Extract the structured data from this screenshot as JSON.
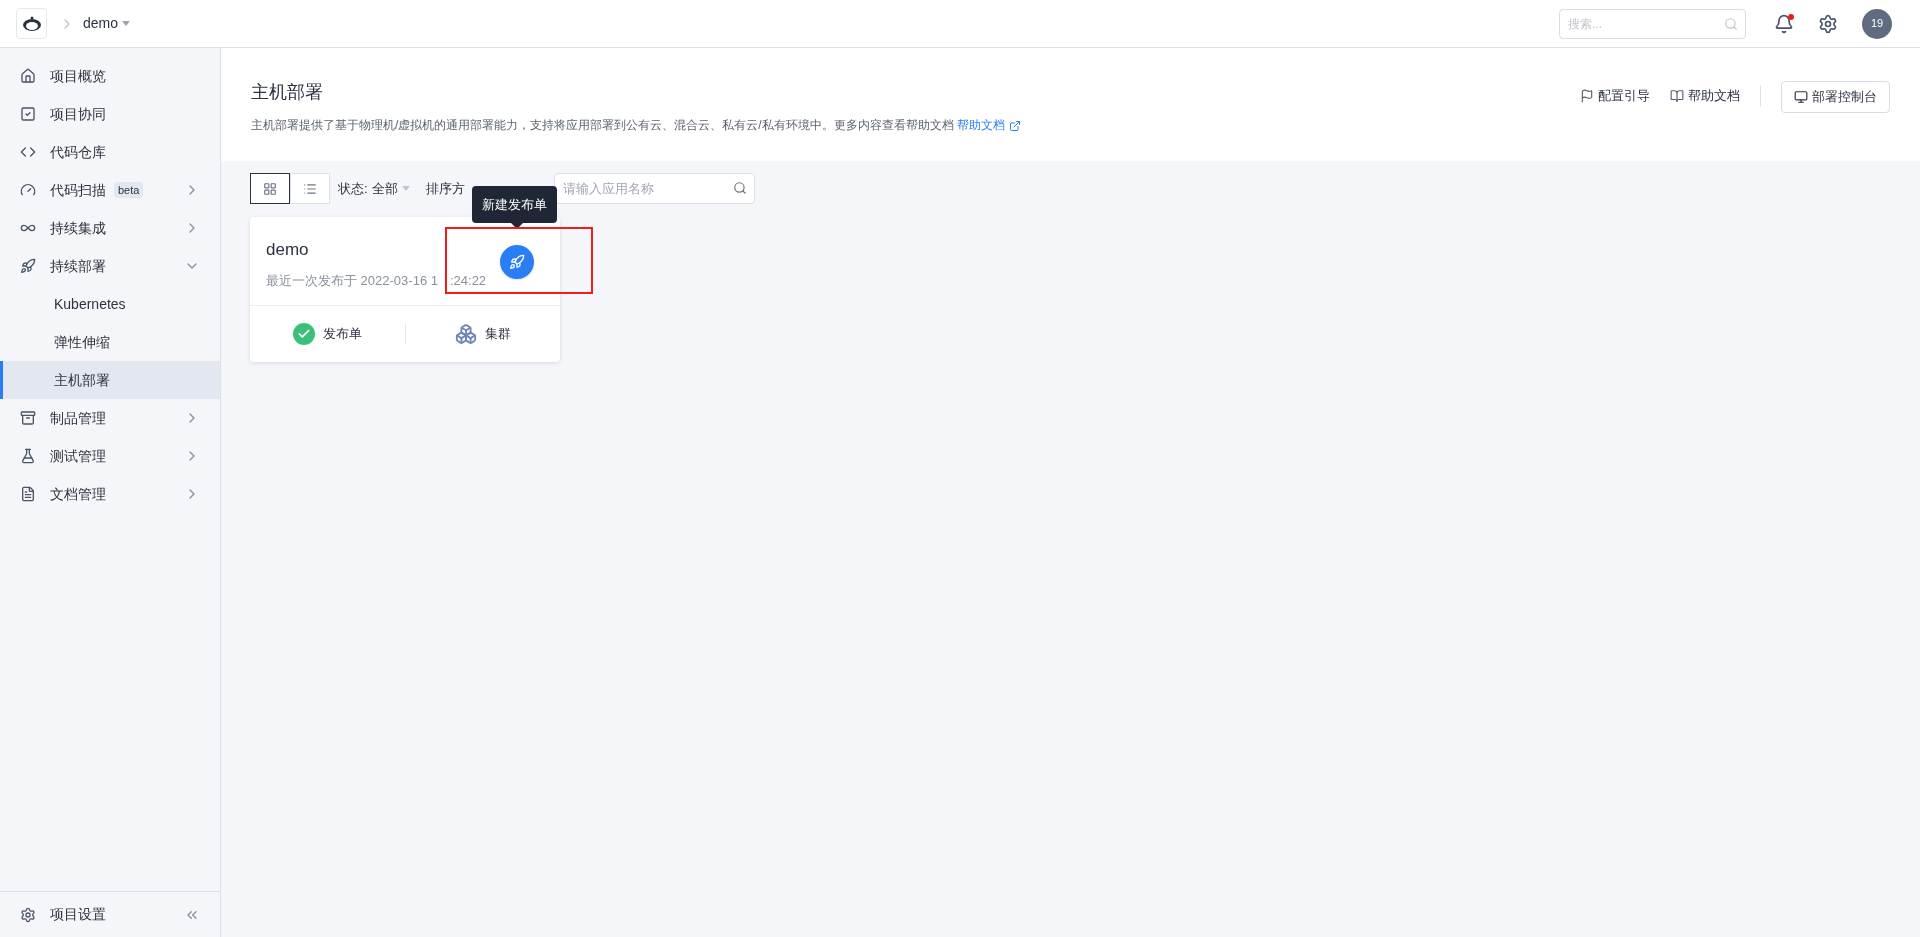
{
  "topbar": {
    "project": "demo",
    "search": {
      "placeholder": "搜索..."
    },
    "notification_unread": true,
    "avatar": "19"
  },
  "sidebar": {
    "items": [
      {
        "kind": "home",
        "label": "项目概览",
        "selected": false
      },
      {
        "kind": "check",
        "label": "项目协同",
        "selected": false
      },
      {
        "kind": "code",
        "label": "代码仓库",
        "selected": false
      },
      {
        "kind": "scan",
        "label": "代码扫描",
        "badge": "beta",
        "expanded": false,
        "selected": false
      },
      {
        "kind": "loop",
        "label": "持续集成",
        "expanded": false,
        "selected": false
      },
      {
        "kind": "rocket",
        "label": "持续部署",
        "expanded": true,
        "selected": false,
        "children": [
          {
            "label": "Kubernetes",
            "selected": false
          },
          {
            "label": "弹性伸缩",
            "selected": false
          },
          {
            "label": "主机部署",
            "selected": true
          }
        ]
      },
      {
        "kind": "box",
        "label": "制品管理",
        "expanded": false,
        "selected": false
      },
      {
        "kind": "flask",
        "label": "测试管理",
        "expanded": false,
        "selected": false
      },
      {
        "kind": "doc",
        "label": "文档管理",
        "expanded": false,
        "selected": false
      }
    ],
    "settings": "项目设置"
  },
  "header": {
    "title": "主机部署",
    "description": "主机部署提供了基于物理机/虚拟机的通用部署能力，支持将应用部署到公有云、混合云、私有云/私有环境中。更多内容查看帮助文档",
    "description_link": "帮助文档",
    "actions": [
      "配置引导",
      "帮助文档"
    ],
    "console_button": "部署控制台"
  },
  "toolbar": {
    "views": [
      {
        "kind": "grid",
        "selected": true
      },
      {
        "kind": "list",
        "selected": false
      }
    ],
    "status_label": "状态:",
    "status_value": "全部",
    "sort_label": "排序方",
    "search": {
      "placeholder": "请输入应用名称"
    }
  },
  "cards": [
    {
      "name": "demo",
      "last_release": "最近一次发布于 2022-03-16 1",
      "last_release_tail": ":24:22",
      "tooltip": "新建发布单",
      "actions": [
        {
          "kind": "release",
          "label": "发布单"
        },
        {
          "kind": "cluster",
          "label": "集群"
        }
      ]
    }
  ]
}
